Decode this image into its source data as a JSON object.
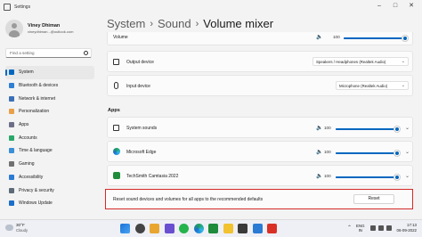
{
  "window": {
    "title": "Settings"
  },
  "profile": {
    "name": "Viney Dhiman",
    "email": "vineydhiman...@outlook.com"
  },
  "search": {
    "placeholder": "Find a setting"
  },
  "nav": [
    {
      "label": "System",
      "icon": "system-icon",
      "color": "#0067c0",
      "active": true
    },
    {
      "label": "Bluetooth & devices",
      "icon": "bluetooth-icon",
      "color": "#2f7fd3"
    },
    {
      "label": "Network & internet",
      "icon": "network-icon",
      "color": "#3b6fb6"
    },
    {
      "label": "Personalization",
      "icon": "brush-icon",
      "color": "#e8a04a"
    },
    {
      "label": "Apps",
      "icon": "apps-icon",
      "color": "#6d6d8a"
    },
    {
      "label": "Accounts",
      "icon": "accounts-icon",
      "color": "#2aa86a"
    },
    {
      "label": "Time & language",
      "icon": "time-language-icon",
      "color": "#3a8fd6"
    },
    {
      "label": "Gaming",
      "icon": "gaming-icon",
      "color": "#707070"
    },
    {
      "label": "Accessibility",
      "icon": "accessibility-icon",
      "color": "#2b7bd4"
    },
    {
      "label": "Privacy & security",
      "icon": "shield-icon",
      "color": "#5e6a78"
    },
    {
      "label": "Windows Update",
      "icon": "update-icon",
      "color": "#1a6fc9"
    }
  ],
  "breadcrumb": {
    "part1": "System",
    "part2": "Sound",
    "current": "Volume mixer",
    "separator": "›"
  },
  "volume": {
    "label": "Volume",
    "value": "100",
    "level": 1.0
  },
  "output": {
    "label": "Output device",
    "selected": "Speakers / Headphones (Realtek Audio)"
  },
  "input": {
    "label": "Input device",
    "selected": "Microphone (Realtek Audio)"
  },
  "apps_section": {
    "label": "Apps"
  },
  "apps": [
    {
      "name": "System sounds",
      "value": "100",
      "level": 1.0,
      "icon": "system-sounds-icon"
    },
    {
      "name": "Microsoft Edge",
      "value": "100",
      "level": 1.0,
      "icon": "edge-icon"
    },
    {
      "name": "TechSmith Camtasia 2022",
      "value": "100",
      "level": 1.0,
      "icon": "camtasia-icon"
    }
  ],
  "reset": {
    "text": "Reset sound devices and volumes for all apps to the recommended defaults",
    "button": "Reset"
  },
  "taskbar": {
    "weather_temp": "30°F",
    "weather_cond": "Cloudy",
    "lang_top": "ENG",
    "lang_bottom": "IN",
    "time": "17:13",
    "date": "06-09-2022"
  },
  "colors": {
    "accent": "#0067c0",
    "highlight_border": "#d42a2a"
  }
}
